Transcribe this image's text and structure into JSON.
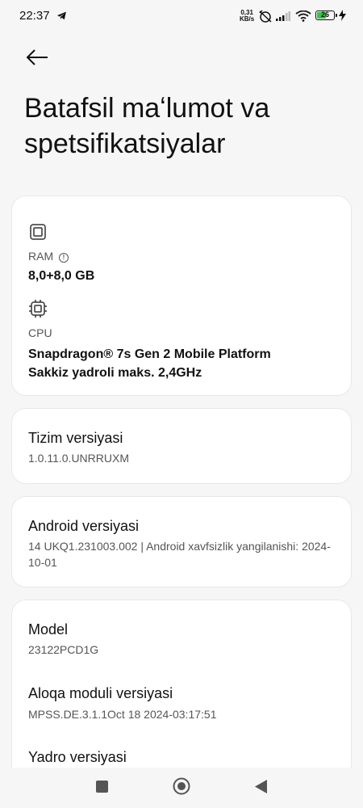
{
  "status_bar": {
    "time": "22:37",
    "net_speed_value": "0,31",
    "net_speed_unit": "KB/s",
    "battery": "26",
    "battery_level_percent": 26,
    "battery_color": "#35c54a"
  },
  "header": {
    "title": "Batafsil maʻlumot va spetsifikatsiyalar"
  },
  "hardware": {
    "ram_label": "RAM",
    "ram_value": "8,0+8,0 GB",
    "cpu_label": "CPU",
    "cpu_value_line1": "Snapdragon® 7s Gen 2 Mobile Platform",
    "cpu_value_line2": "Sakkiz yadroli maks. 2,4GHz"
  },
  "system_version": {
    "title": "Tizim versiyasi",
    "value": "1.0.11.0.UNRRUXM"
  },
  "android_version": {
    "title": "Android versiyasi",
    "value": "14 UKQ1.231003.002 | Android xavfsizlik yangilanishi: 2024-10-01"
  },
  "device": {
    "model_title": "Model",
    "model_value": "23122PCD1G",
    "baseband_title": "Aloqa moduli versiyasi",
    "baseband_value": "MPSS.DE.3.1.1Oct 18 2024-03:17:51",
    "kernel_title": "Yadro versiyasi"
  },
  "icons": {
    "back": "arrow-left-icon",
    "ram": "memory-chip-icon",
    "cpu": "processor-chip-icon",
    "info": "info-icon",
    "nav_recents": "square-icon",
    "nav_home": "circle-icon",
    "nav_back": "triangle-back-icon"
  }
}
